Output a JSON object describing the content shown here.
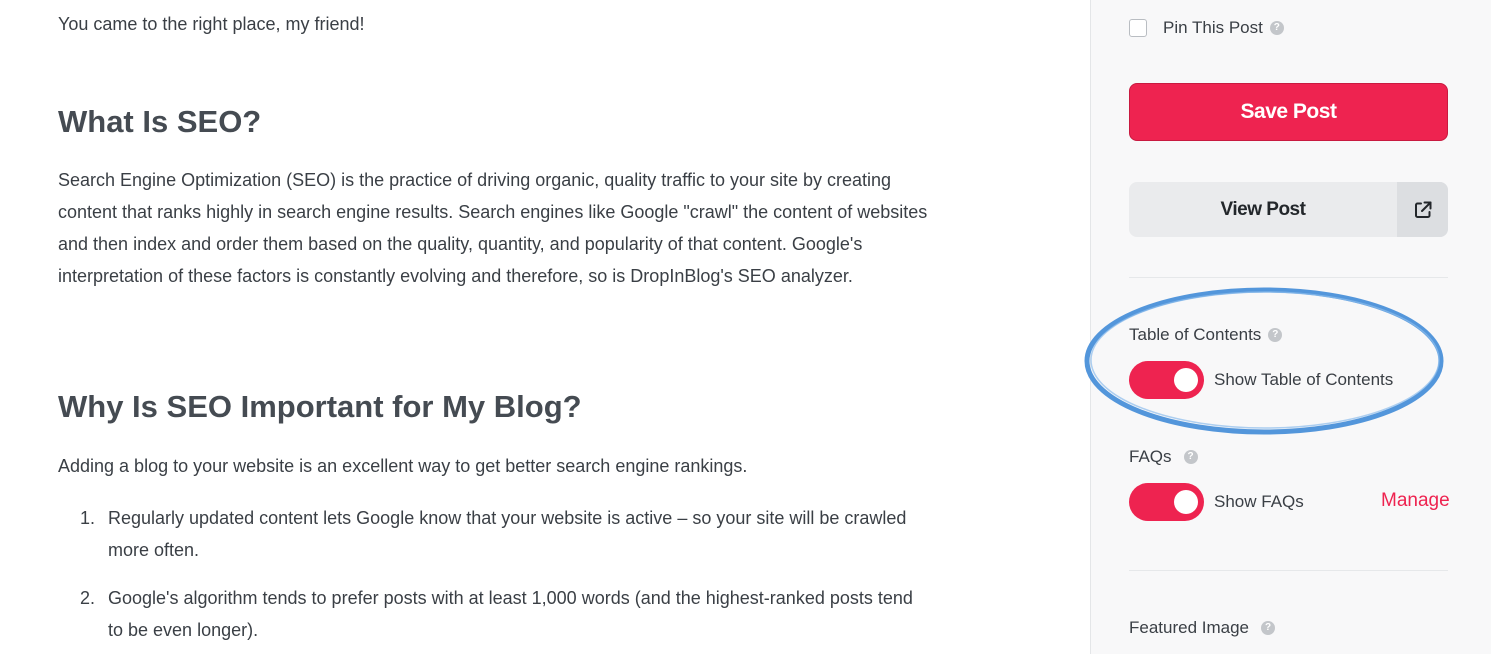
{
  "article": {
    "intro": "You came to the right place, my friend!",
    "heading1": "What Is SEO?",
    "paragraph1": "Search Engine Optimization (SEO) is the practice of driving organic, quality traffic to your site by creating content that ranks highly in search engine results. Search engines like Google \"crawl\" the content of websites and then index and order them based on the quality, quantity, and popularity of that content. Google's interpretation of these factors is constantly evolving and therefore, so is DropInBlog's SEO analyzer.",
    "heading2": "Why Is SEO Important for My Blog?",
    "paragraph2": "Adding a blog to your website is an excellent way to get better search engine rankings.",
    "list": [
      {
        "num": "1.",
        "text": "Regularly updated content lets Google know that your website is active – so your site will be crawled more often."
      },
      {
        "num": "2.",
        "text": "Google's algorithm tends to prefer posts with at least 1,000 words (and the highest-ranked posts tend to be even longer)."
      }
    ]
  },
  "sidebar": {
    "pin_label": "Pin This Post",
    "pin_checked": false,
    "save_label": "Save Post",
    "view_label": "View Post",
    "toc_label": "Table of Contents",
    "toc_toggle_label": "Show Table of Contents",
    "toc_enabled": true,
    "faq_label": "FAQs",
    "faq_toggle_label": "Show FAQs",
    "faq_enabled": true,
    "manage_label": "Manage",
    "featured_label": "Featured Image",
    "help_glyph": "?"
  },
  "icons": {
    "help": "question-circle-icon",
    "external": "external-link-icon"
  },
  "colors": {
    "accent": "#ee2350",
    "highlight_ring": "#4a90d9",
    "sidebar_bg": "#f8f8f9",
    "text": "#3a3f45"
  }
}
